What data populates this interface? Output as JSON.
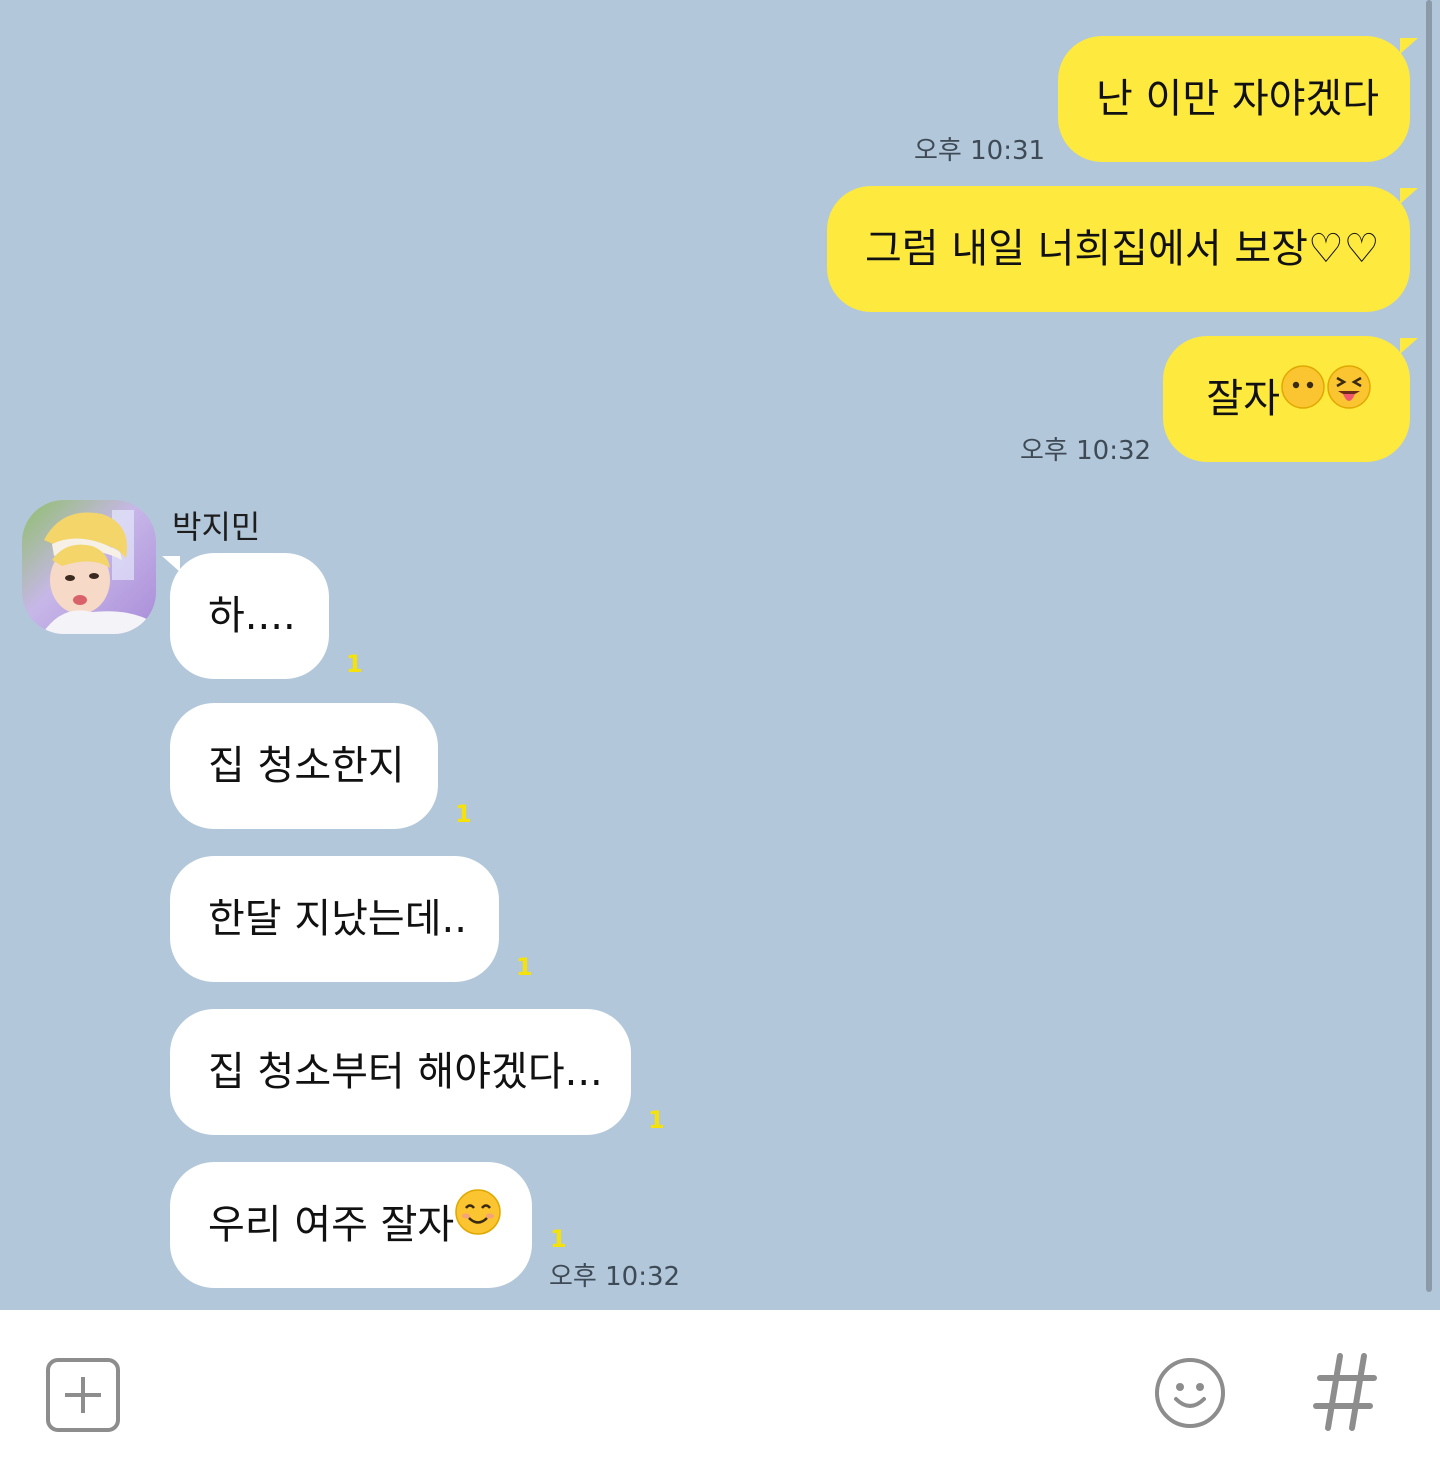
{
  "sent_messages": [
    {
      "text": "난 이만 자야겠다",
      "time": "오후 10:31"
    },
    {
      "text": "그럼 내일 너희집에서 보장♡♡",
      "time": ""
    },
    {
      "text": "잘자",
      "time": "오후 10:32",
      "emojis": [
        "neutral-face-emoji",
        "squinting-tongue-face-emoji"
      ]
    }
  ],
  "received": {
    "sender": "박지민",
    "messages": [
      {
        "text": "하....",
        "unread": "1"
      },
      {
        "text": "집 청소한지",
        "unread": "1"
      },
      {
        "text": "한달 지났는데..",
        "unread": "1"
      },
      {
        "text": "집 청소부터 해야겠다...",
        "unread": "1"
      },
      {
        "text": "우리 여주 잘자",
        "unread": "1",
        "time": "오후 10:32",
        "emojis": [
          "smiling-face-emoji"
        ]
      }
    ]
  },
  "input_bar": {
    "plus_icon": "plus-square-icon",
    "emoji_icon": "smiley-icon",
    "hash_icon": "hash-icon"
  },
  "colors": {
    "chat_background": "#b2c7da",
    "my_bubble": "#fee93f",
    "their_bubble": "#ffffff",
    "unread_count": "#f5e20a"
  }
}
